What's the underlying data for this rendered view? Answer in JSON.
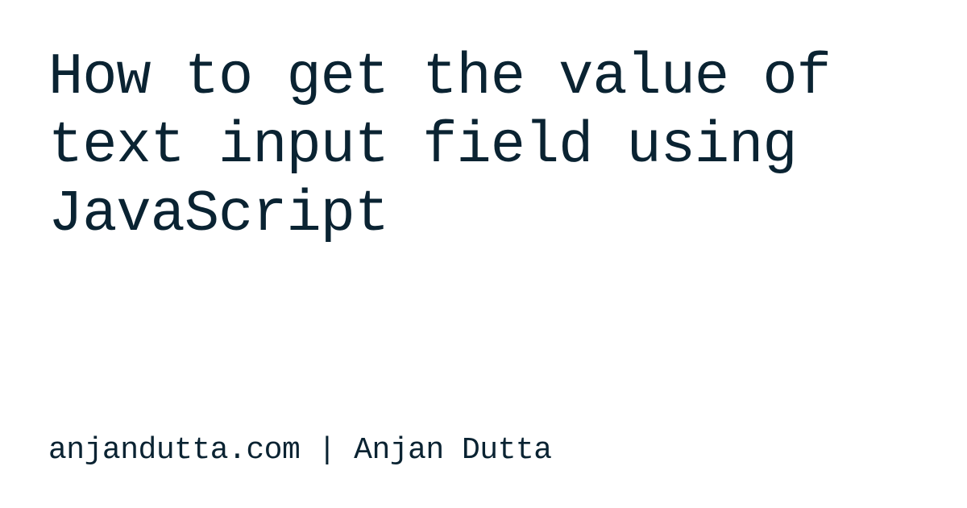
{
  "title": "How to get the value of text input field using JavaScript",
  "byline": "anjandutta.com | Anjan Dutta"
}
